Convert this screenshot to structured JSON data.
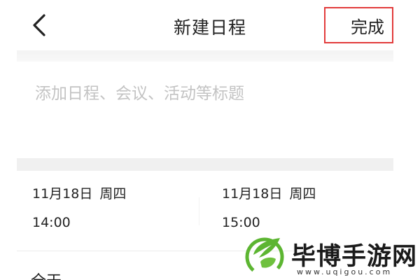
{
  "header": {
    "back_icon": "chevron-left-icon",
    "title": "新建日程",
    "done_label": "完成",
    "done_highlight_color": "#e23b3b"
  },
  "event": {
    "title_value": "",
    "title_placeholder": "添加日程、会议、活动等标题"
  },
  "start": {
    "date": "11月18日",
    "weekday": "周四",
    "time": "14:00"
  },
  "end": {
    "date": "11月18日",
    "weekday": "周四",
    "time": "15:00"
  },
  "all_day_label": "全天",
  "watermark": {
    "icon": "leaf-logo-icon",
    "name": "毕博手游网",
    "url": "www.uqigou.com",
    "logo_color": "#5cb531"
  }
}
